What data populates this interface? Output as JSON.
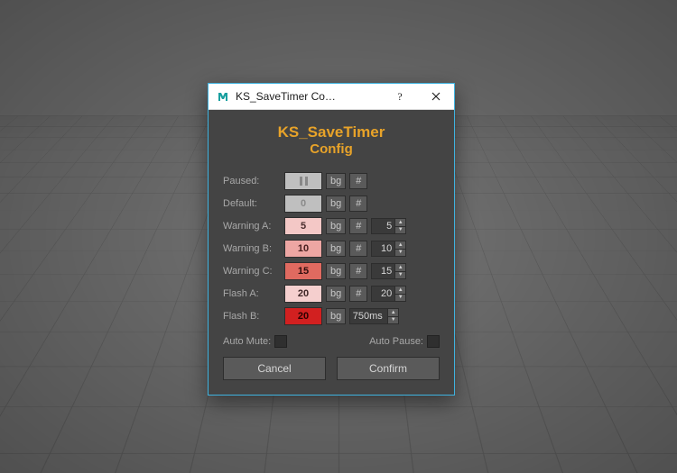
{
  "window": {
    "title": "KS_SaveTimer Co…"
  },
  "heading": {
    "title": "KS_SaveTimer",
    "subtitle": "Config"
  },
  "rows": {
    "paused": {
      "label": "Paused:",
      "swatch_bg": "#bfbfbf",
      "swatch_fg": "#7a7a7a",
      "swatch_text": "",
      "is_pause_icon": true,
      "bg": "bg",
      "hash": "#",
      "spin": null
    },
    "default": {
      "label": "Default:",
      "swatch_bg": "#bfbfbf",
      "swatch_fg": "#8a8a8a",
      "swatch_text": "0",
      "is_pause_icon": false,
      "bg": "bg",
      "hash": "#",
      "spin": null
    },
    "warnA": {
      "label": "Warning A:",
      "swatch_bg": "#f4c8c6",
      "swatch_fg": "#4a2e2e",
      "swatch_text": "5",
      "is_pause_icon": false,
      "bg": "bg",
      "hash": "#",
      "spin": "5"
    },
    "warnB": {
      "label": "Warning B:",
      "swatch_bg": "#eda6a3",
      "swatch_fg": "#4a2020",
      "swatch_text": "10",
      "is_pause_icon": false,
      "bg": "bg",
      "hash": "#",
      "spin": "10"
    },
    "warnC": {
      "label": "Warning C:",
      "swatch_bg": "#e06a60",
      "swatch_fg": "#2e0d0d",
      "swatch_text": "15",
      "is_pause_icon": false,
      "bg": "bg",
      "hash": "#",
      "spin": "15"
    },
    "flashA": {
      "label": "Flash A:",
      "swatch_bg": "#f5cfce",
      "swatch_fg": "#3d2525",
      "swatch_text": "20",
      "is_pause_icon": false,
      "bg": "bg",
      "hash": "#",
      "spin": "20"
    },
    "flashB": {
      "label": "Flash B:",
      "swatch_bg": "#d22020",
      "swatch_fg": "#2b0000",
      "swatch_text": "20",
      "is_pause_icon": false,
      "bg": "bg",
      "hash": null,
      "ms": "750ms"
    }
  },
  "footer": {
    "auto_mute": "Auto Mute:",
    "auto_pause": "Auto Pause:"
  },
  "buttons": {
    "cancel": "Cancel",
    "confirm": "Confirm"
  }
}
